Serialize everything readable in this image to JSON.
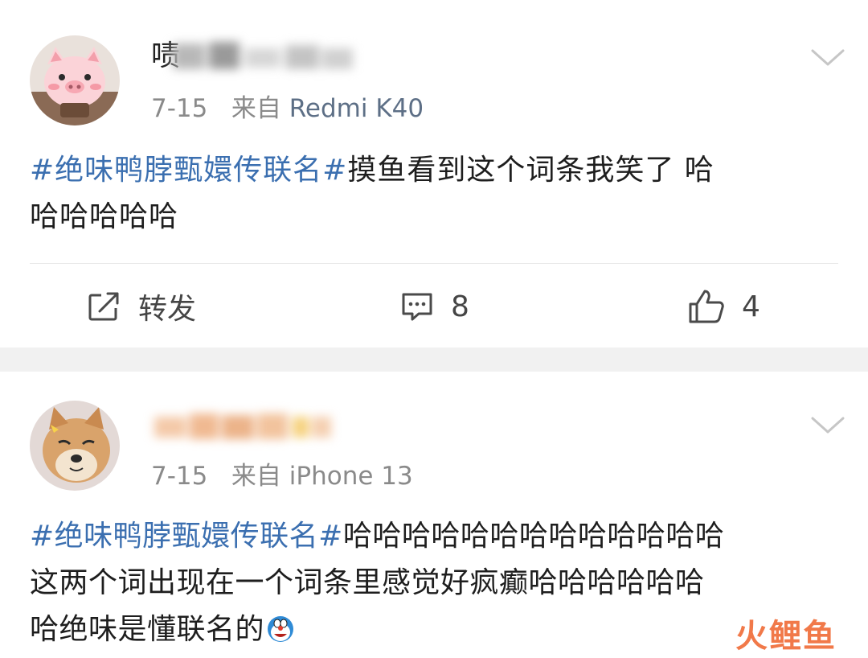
{
  "posts": [
    {
      "username_visible_prefix": "啧",
      "date": "7-15",
      "source_prefix": "来自",
      "device": "Redmi K40",
      "hashtag": "#绝味鸭脖甄嬛传联名#",
      "text_line1_rest": "摸鱼看到这个词条我笑了 哈",
      "text_line2": "哈哈哈哈哈",
      "avatar_icon": "pig-avatar",
      "actions": {
        "repost_label": "转发",
        "comment_count": "8",
        "like_count": "4"
      }
    },
    {
      "date": "7-15",
      "source_prefix": "来自",
      "device": "iPhone 13",
      "hashtag": "#绝味鸭脖甄嬛传联名#",
      "text_line1_rest": "哈哈哈哈哈哈哈哈哈哈哈哈哈",
      "text_line2": "这两个词出现在一个词条里感觉好疯癫哈哈哈哈哈哈",
      "text_line3": "哈绝味是懂联名的",
      "avatar_icon": "shiba-dog-avatar",
      "emoji": "doraemon-emoji"
    }
  ],
  "watermark": "火鲤鱼",
  "colors": {
    "hashtag": "#3b6fb0",
    "device": "#5d6f86",
    "meta": "#8a8a8a",
    "band": "#f1f1f1",
    "watermark": "#f06e3a"
  }
}
